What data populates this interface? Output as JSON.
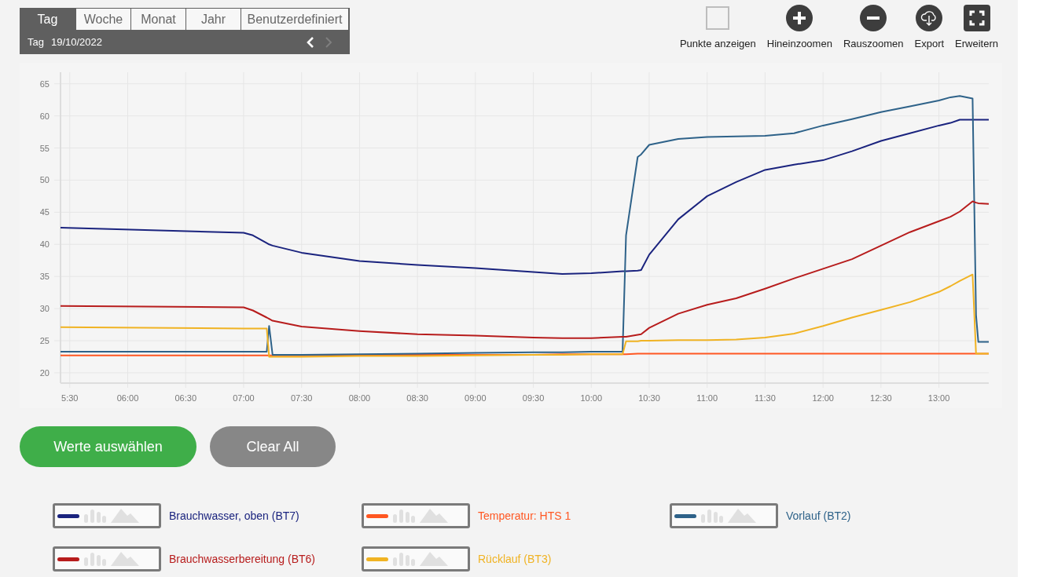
{
  "period_tabs": [
    {
      "label": "Tag",
      "selected": true
    },
    {
      "label": "Woche",
      "selected": false
    },
    {
      "label": "Monat",
      "selected": false
    },
    {
      "label": "Jahr",
      "selected": false
    },
    {
      "label": "Benutzerdefiniert",
      "selected": false
    }
  ],
  "date_bar": {
    "period": "Tag",
    "date": "19/10/2022",
    "prev": {
      "disabled": false
    },
    "next": {
      "disabled": true
    }
  },
  "toolbar": [
    {
      "kind": "checkbox",
      "label": "Punkte anzeigen",
      "checked": false
    },
    {
      "kind": "zoom-in",
      "label": "Hineinzoomen"
    },
    {
      "kind": "zoom-out",
      "label": "Rauszoomen"
    },
    {
      "kind": "export",
      "label": "Export"
    },
    {
      "kind": "expand",
      "label": "Erweitern"
    }
  ],
  "chart": {
    "chart_data": {
      "type": "line",
      "grid": true,
      "xlim": [
        5.42,
        13.43
      ],
      "ylim": [
        18.4,
        66.8
      ],
      "xticks": [
        {
          "value": 5.5,
          "label": "5:30"
        },
        {
          "value": 6,
          "label": "06:00"
        },
        {
          "value": 6.5,
          "label": "06:30"
        },
        {
          "value": 7,
          "label": "07:00"
        },
        {
          "value": 7.5,
          "label": "07:30"
        },
        {
          "value": 8,
          "label": "08:00"
        },
        {
          "value": 8.5,
          "label": "08:30"
        },
        {
          "value": 9,
          "label": "09:00"
        },
        {
          "value": 9.5,
          "label": "09:30"
        },
        {
          "value": 10,
          "label": "10:00"
        },
        {
          "value": 10.5,
          "label": "10:30"
        },
        {
          "value": 11,
          "label": "11:00"
        },
        {
          "value": 11.5,
          "label": "11:30"
        },
        {
          "value": 12,
          "label": "12:00"
        },
        {
          "value": 12.5,
          "label": "12:30"
        },
        {
          "value": 13,
          "label": "13:00"
        }
      ],
      "yticks": [
        20,
        25,
        30,
        35,
        40,
        45,
        50,
        55,
        60,
        65
      ],
      "x": [
        5.42,
        7.0,
        7.08,
        7.2,
        7.22,
        7.25,
        7.5,
        8,
        8.5,
        9,
        9.5,
        9.75,
        10,
        10.27,
        10.3,
        10.4,
        10.43,
        10.5,
        10.75,
        11,
        11.25,
        11.5,
        11.75,
        12,
        12.25,
        12.5,
        12.75,
        13,
        13.1,
        13.18,
        13.29,
        13.32,
        13.34,
        13.43
      ],
      "series": [
        {
          "name": "Brauchwasser, oben (BT7)",
          "color": "#1a237e",
          "values": [
            42.6,
            41.8,
            41.4,
            40.2,
            40.0,
            39.8,
            38.7,
            37.4,
            36.8,
            36.3,
            35.7,
            35.4,
            35.5,
            35.8,
            35.8,
            35.9,
            36.0,
            38.4,
            43.9,
            47.5,
            49.7,
            51.6,
            52.4,
            53.1,
            54.5,
            56.1,
            57.3,
            58.5,
            58.9,
            59.4,
            59.4,
            59.4,
            59.4,
            59.4
          ]
        },
        {
          "name": "Temperatur: HTS 1",
          "color": "#ff5722",
          "values": [
            22.7,
            22.7,
            22.7,
            22.7,
            22.7,
            22.7,
            22.7,
            22.8,
            22.8,
            22.8,
            22.8,
            22.9,
            22.9,
            22.9,
            22.9,
            23.0,
            23.0,
            23.0,
            23.0,
            23.0,
            23.0,
            23.0,
            23.0,
            23.0,
            23.0,
            23.0,
            23.0,
            23.0,
            23.0,
            23.0,
            23.0,
            23.0,
            23.0,
            23.0
          ]
        },
        {
          "name": "Vorlauf (BT2)",
          "color": "#2e6289",
          "values": [
            23.3,
            23.3,
            23.3,
            23.3,
            27.3,
            22.8,
            22.8,
            22.9,
            23.0,
            23.1,
            23.2,
            23.2,
            23.3,
            23.3,
            41.4,
            53.6,
            54.0,
            55.5,
            56.4,
            56.7,
            56.8,
            56.9,
            57.3,
            58.5,
            59.5,
            60.6,
            61.5,
            62.4,
            62.9,
            63.1,
            62.7,
            29.0,
            24.8,
            24.8
          ]
        },
        {
          "name": "Brauchwasserbereitung (BT6)",
          "color": "#b71c1c",
          "values": [
            30.4,
            30.2,
            29.7,
            28.6,
            28.4,
            28.1,
            27.2,
            26.5,
            26.0,
            25.8,
            25.5,
            25.4,
            25.4,
            25.6,
            25.6,
            25.9,
            26.0,
            27.0,
            29.2,
            30.6,
            31.6,
            33.1,
            34.7,
            36.2,
            37.7,
            39.8,
            41.9,
            43.6,
            44.3,
            45.1,
            46.7,
            46.5,
            46.4,
            46.3
          ]
        },
        {
          "name": "Rücklauf (BT3)",
          "color": "#f0b323",
          "values": [
            27.1,
            26.9,
            26.9,
            26.9,
            22.5,
            22.5,
            22.5,
            22.6,
            22.6,
            22.7,
            22.8,
            22.8,
            22.9,
            22.9,
            24.9,
            24.9,
            25.0,
            25.0,
            25.1,
            25.1,
            25.2,
            25.5,
            26.1,
            27.3,
            28.6,
            29.8,
            31.0,
            32.6,
            33.5,
            34.3,
            35.3,
            23.0,
            23.0,
            23.0
          ]
        }
      ]
    }
  },
  "actions": [
    {
      "kind": "primary",
      "label": "Werte auswählen"
    },
    {
      "kind": "secondary",
      "label": "Clear All"
    }
  ]
}
